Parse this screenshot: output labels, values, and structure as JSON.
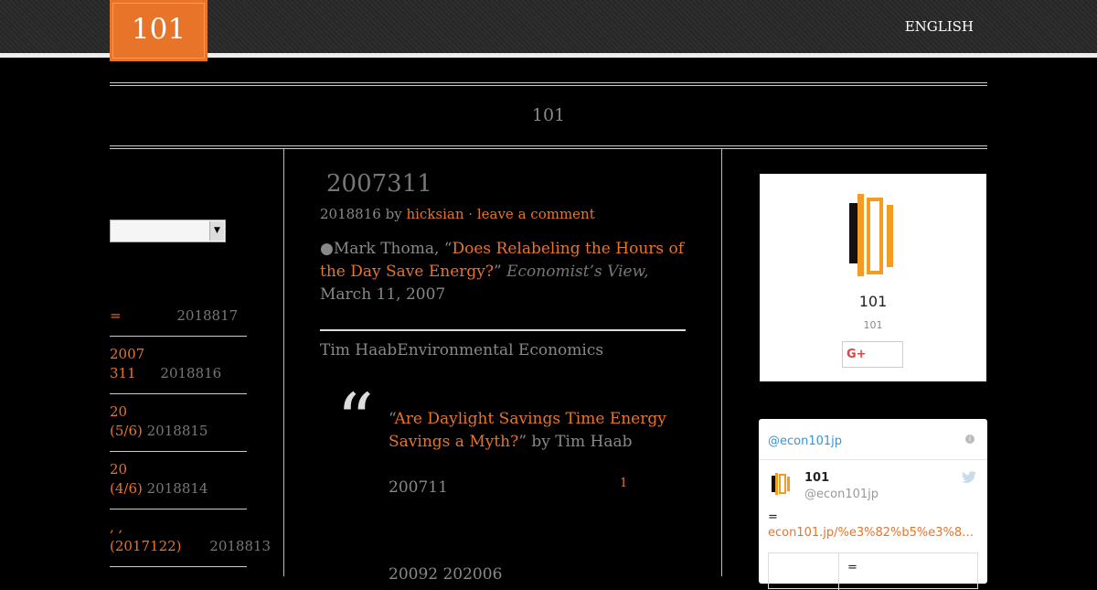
{
  "header": {
    "logo_text": "101",
    "language_link": "ENGLISH"
  },
  "site": {
    "title": "101"
  },
  "sidebar": {
    "items": [
      {
        "title": "=",
        "date": "2018817"
      },
      {
        "title_line1": " 2007",
        "title_line2": "311",
        "date": "2018816"
      },
      {
        "title_line1": "20",
        "title_line2": "(5/6)",
        "date": "2018815"
      },
      {
        "title_line1": "20",
        "title_line2": "(4/6)",
        "date": "2018814"
      },
      {
        "title_line1": ", ,",
        "title_line2": "(2017122)",
        "date": "2018813"
      }
    ]
  },
  "post": {
    "title": " 2007311",
    "meta_date": "2018816",
    "meta_by": "by",
    "meta_author": "hicksian",
    "meta_sep": "·",
    "meta_comment": "leave a comment",
    "para1_prefix": "●Mark Thoma, “",
    "para1_link": "Does Relabeling the Hours of the Day Save Energy?",
    "para1_mid": "”  ",
    "para1_source": "Economist’s View,",
    "para1_suffix": " March 11, 2007",
    "para2": "Tim HaabEnvironmental Economics",
    "quote_mark": "“",
    "quote_prefix": "“",
    "quote_link": "Are Daylight Savings Time Energy Savings a Myth?",
    "quote_suffix": "” by Tim Haab",
    "para3": "200711",
    "footnote": "1",
    "para4": "20092        202006"
  },
  "widget_gplus": {
    "brand_name": "101",
    "brand_sub": "101",
    "button_label": "G+"
  },
  "widget_twitter": {
    "header_handle": "@econ101jp",
    "info_label": "i",
    "name": "101",
    "handle": "@econ101jp",
    "tweet_text": "=",
    "tweet_link": "econ101.jp/%e3%82%b5%e3%8…",
    "card_text": "="
  },
  "colors": {
    "accent": "#e8742a",
    "background": "#000000"
  }
}
